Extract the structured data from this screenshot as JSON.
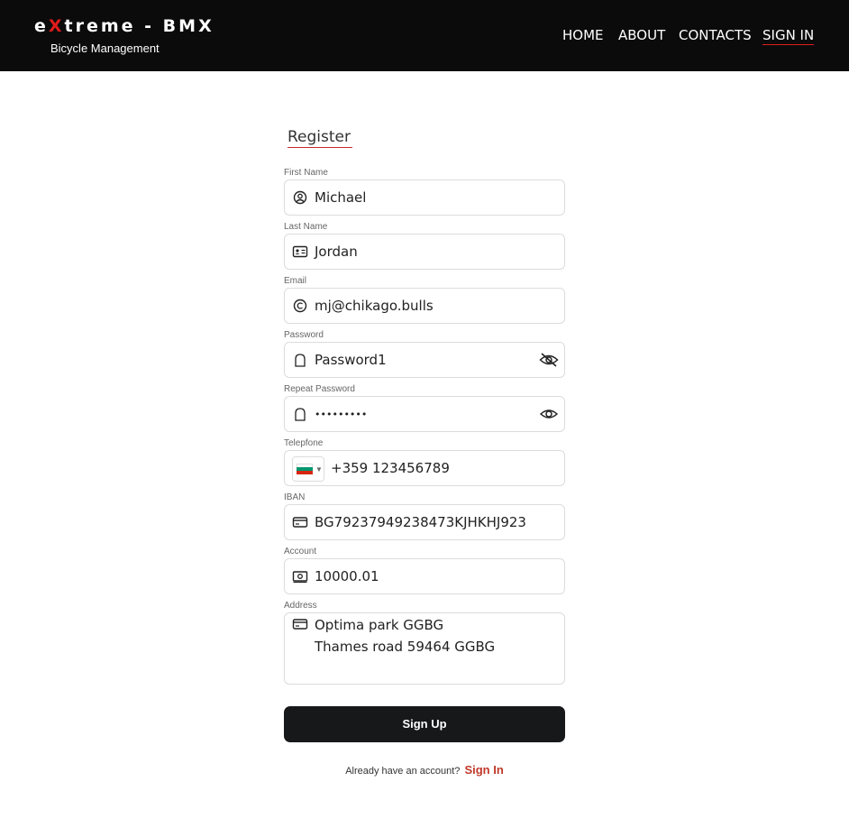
{
  "header": {
    "logo_prefix": "e",
    "logo_x": "X",
    "logo_rest": "treme - BMX",
    "subtitle": "Bicycle Management",
    "nav": [
      "HOME",
      "ABOUT",
      "CONTACTS",
      "SIGN IN"
    ]
  },
  "form": {
    "title": "Register",
    "first_name": {
      "label": "First Name",
      "value": "Michael"
    },
    "last_name": {
      "label": "Last Name",
      "value": "Jordan"
    },
    "email": {
      "label": "Email",
      "value": "mj@chikago.bulls"
    },
    "password": {
      "label": "Password",
      "value": "Password1"
    },
    "repeat_password": {
      "label": "Repeat Password",
      "value": "•••••••••"
    },
    "telephone": {
      "label": "Telepfone",
      "value": "+359 123456789",
      "flag_colors": [
        "#ffffff",
        "#00966e",
        "#d62612"
      ]
    },
    "iban": {
      "label": "IBAN",
      "value": "BG79237949238473KJHKHJ923"
    },
    "account": {
      "label": "Account",
      "value": "10000.01"
    },
    "address": {
      "label": "Address",
      "line1": "Optima park GGBG",
      "line2": "Thames road 59464 GGBG"
    },
    "submit_label": "Sign Up",
    "footer_text": "Already have an account?",
    "footer_link": "Sign In"
  },
  "colors": {
    "accent": "#e01b1b",
    "header_bg": "#0b0b0b",
    "button_bg": "#17181a",
    "link": "#c0392b"
  }
}
